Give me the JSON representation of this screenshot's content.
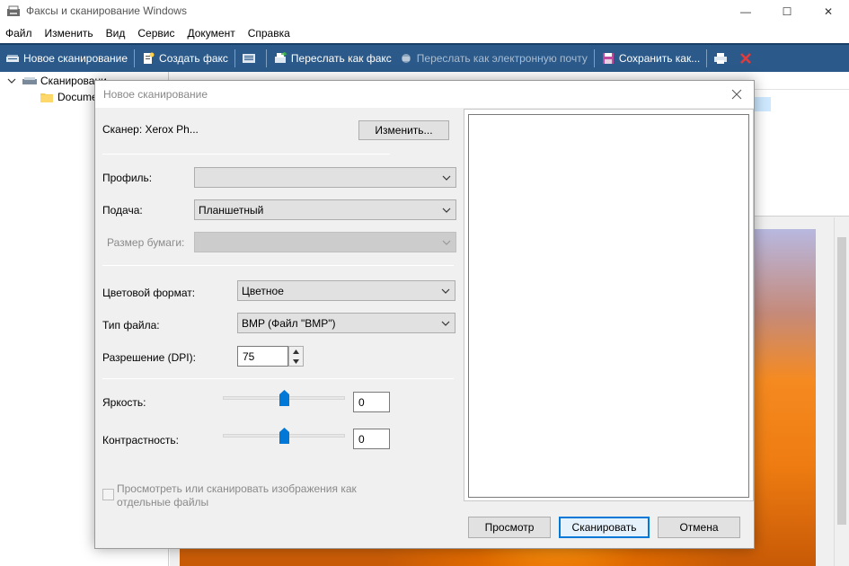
{
  "window": {
    "title": "Факсы и сканирование Windows",
    "controls": {
      "minimize": "—",
      "maximize": "☐",
      "close": "✕"
    }
  },
  "menu": [
    "Файл",
    "Изменить",
    "Вид",
    "Сервис",
    "Документ",
    "Справка"
  ],
  "toolbar": {
    "new_scan": "Новое сканирование",
    "create_fax": "Создать факс",
    "forward_fax": "Переслать как факс",
    "forward_email": "Переслать как электронную почту",
    "save_as": "Сохранить как..."
  },
  "tree": {
    "scans": "Сканировани",
    "documents": "Docume"
  },
  "dialog": {
    "title": "Новое сканирование",
    "scanner_label": "Сканер: Xerox Ph...",
    "change_button": "Изменить...",
    "profile_label": "Профиль:",
    "profile_value": "",
    "source_label": "Подача:",
    "source_value": "Планшетный",
    "paper_size_label": "Размер бумаги:",
    "paper_size_value": "",
    "color_format_label": "Цветовой формат:",
    "color_format_value": "Цветное",
    "file_type_label": "Тип файла:",
    "file_type_value": "BMP (Файл \"BMP\")",
    "resolution_label": "Разрешение (DPI):",
    "resolution_value": "75",
    "brightness_label": "Яркость:",
    "brightness_value": "0",
    "contrast_label": "Контрастность:",
    "contrast_value": "0",
    "separate_files_line1": "Просмотреть или сканировать изображения как",
    "separate_files_line2": "отдельные файлы",
    "preview_button": "Просмотр",
    "scan_button": "Сканировать",
    "cancel_button": "Отмена"
  },
  "colors": {
    "toolbar_bg": "#2b5a8a",
    "accent": "#0078d7",
    "slider_thumb": "#0078d7"
  }
}
